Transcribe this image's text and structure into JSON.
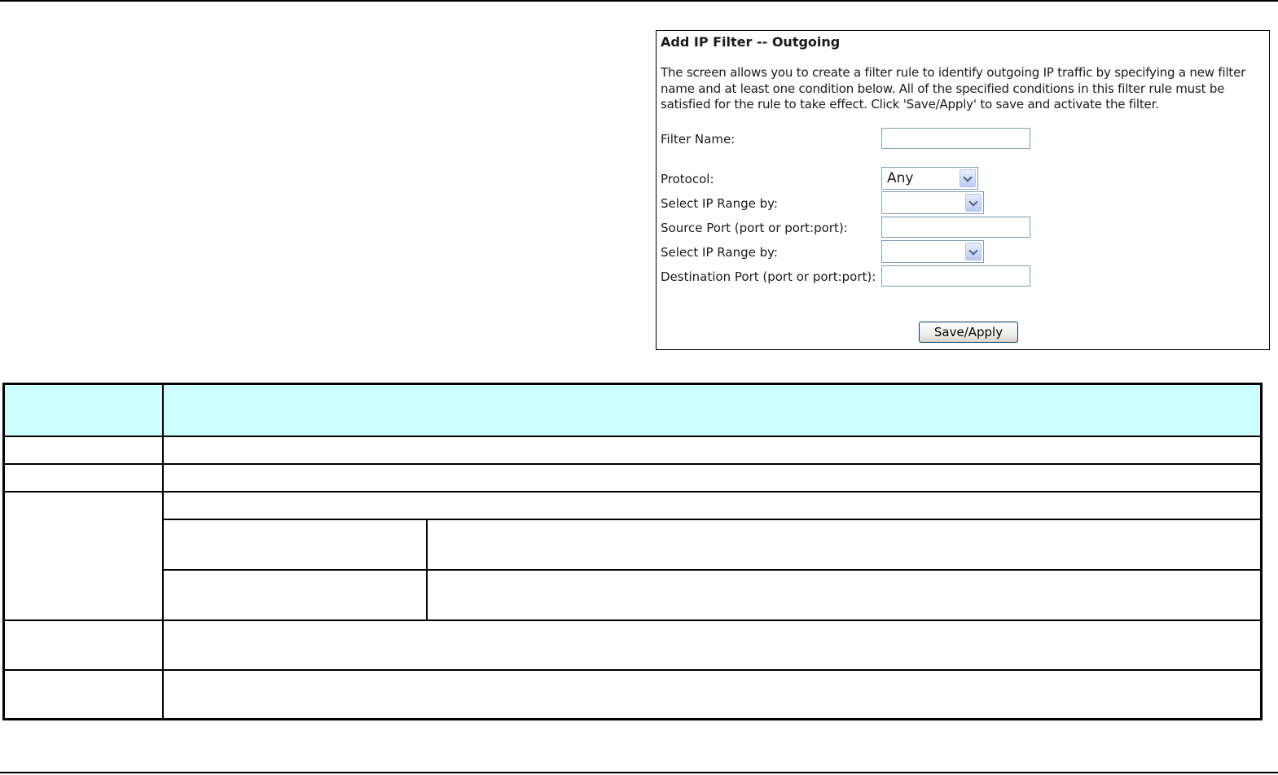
{
  "panel": {
    "title": "Add IP Filter -- Outgoing",
    "description": "The screen allows you to create a filter rule to identify outgoing IP traffic by specifying a new filter name and at least one condition below. All of the specified conditions in this filter rule must be satisfied for the rule to take effect. Click 'Save/Apply' to save and activate the filter.",
    "fields": {
      "filter_name_label": "Filter Name:",
      "filter_name_value": "",
      "protocol_label": "Protocol:",
      "protocol_value": "Any",
      "source_ip_range_label": "Select IP Range by:",
      "source_ip_range_value": "",
      "source_port_label": "Source Port (port or port:port):",
      "source_port_value": "",
      "dest_ip_range_label": "Select IP Range by:",
      "dest_ip_range_value": "",
      "dest_port_label": "Destination Port (port or port:port):",
      "dest_port_value": ""
    },
    "save_button": "Save/Apply"
  },
  "colors": {
    "table_header_bg": "#ccffff",
    "input_border": "#7f9db9",
    "button_border": "#003c74"
  }
}
